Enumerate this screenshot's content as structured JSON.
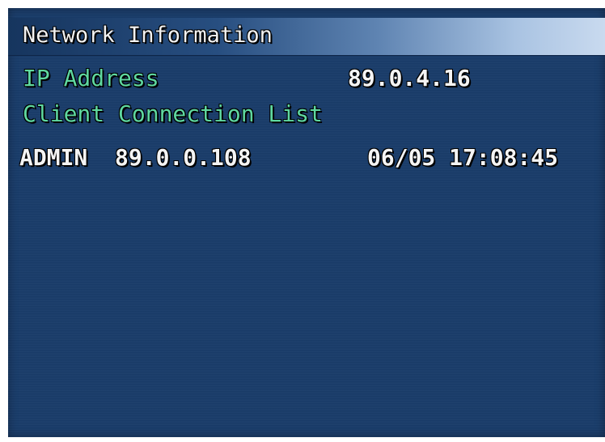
{
  "title": "Network Information",
  "ip_address": {
    "label": "IP Address",
    "value": "89.0.4.16"
  },
  "client_list": {
    "heading": "Client Connection List",
    "entries": [
      {
        "user": "ADMIN",
        "ip": "89.0.0.108",
        "timestamp": "06/05 17:08:45"
      }
    ]
  },
  "colors": {
    "background": "#1a3d6b",
    "label_green": "#5fd8a0",
    "value_white": "#f4f4f4"
  }
}
